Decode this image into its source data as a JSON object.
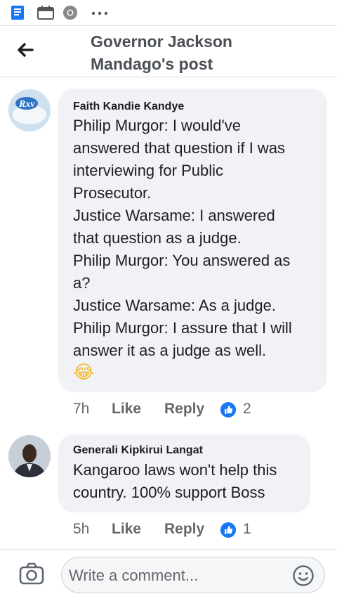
{
  "status_bar": {
    "more_icon": "more-dots"
  },
  "header": {
    "title_line1": "Governor Jackson",
    "title_line2": "Mandago's post"
  },
  "comments": [
    {
      "author": "Faith Kandie Kandye",
      "text": "Philip Murgor: I would've\nanswered that question if I was\ninterviewing for Public\nProsecutor.\nJustice Warsame: I answered\nthat question as a judge.\nPhilip Murgor: You answered as\na?\nJustice Warsame: As a judge.\nPhilip Murgor: I assure that I will\nanswer it as a judge as well.",
      "emoji": "😂",
      "time": "7h",
      "like_label": "Like",
      "reply_label": "Reply",
      "reactions": "2"
    },
    {
      "author": "Generali Kipkirui Langat",
      "text": "Kangaroo laws won't help this\ncountry. 100% support Boss",
      "time": "5h",
      "like_label": "Like",
      "reply_label": "Reply",
      "reactions": "1"
    }
  ],
  "composer": {
    "placeholder": "Write a comment..."
  },
  "colors": {
    "like_blue": "#1877f2",
    "bubble": "#f0f2f5",
    "meta_grey": "#65676b"
  }
}
